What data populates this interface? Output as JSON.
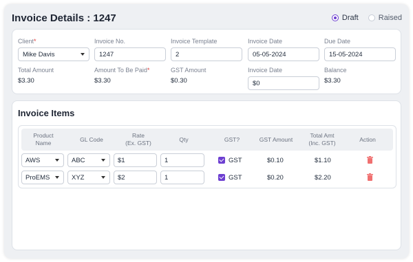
{
  "header": {
    "title": "Invoice Details : 1247",
    "status_options": [
      {
        "label": "Draft",
        "selected": true
      },
      {
        "label": "Raised",
        "selected": false
      }
    ]
  },
  "details": {
    "client_label": "Client",
    "client_value": "Mike Davis",
    "invoice_no_label": "Invoice No.",
    "invoice_no_value": "1247",
    "template_label": "Invoice Template",
    "template_value": "2",
    "invoice_date_label": "Invoice Date",
    "invoice_date_value": "05-05-2024",
    "due_date_label": "Due Date",
    "due_date_value": "15-05-2024",
    "total_label": "Total Amount",
    "total_value": "$3.30",
    "to_be_paid_label": "Amount To Be Paid",
    "to_be_paid_value": "$3.30",
    "gst_label": "GST Amount",
    "gst_value": "$0.30",
    "invoice_date2_label": "Invoice Date",
    "invoice_date2_value": "$0",
    "balance_label": "Balance",
    "balance_value": "$3.30",
    "required_mark": "*"
  },
  "items": {
    "title": "Invoice Items",
    "columns": {
      "product_1": "Product",
      "product_2": "Name",
      "gl_code": "GL Code",
      "rate_1": "Rate",
      "rate_2": "(Ex. GST)",
      "qty": "Qty",
      "gst": "GST?",
      "gst_amount": "GST Amount",
      "total_1": "Total Amt",
      "total_2": "(Inc. GST)",
      "action": "Action"
    },
    "rows": [
      {
        "product": "AWS",
        "gl_code": "ABC",
        "rate": "$1",
        "qty": "1",
        "gst_checked": true,
        "gst_label": "GST",
        "gst_amount": "$0.10",
        "total": "$1.10"
      },
      {
        "product": "ProEMS",
        "gl_code": "XYZ",
        "rate": "$2",
        "qty": "1",
        "gst_checked": true,
        "gst_label": "GST",
        "gst_amount": "$0.20",
        "total": "$2.20"
      }
    ]
  },
  "colors": {
    "accent": "#6d3fd1",
    "danger": "#f07070"
  },
  "icons": {
    "delete": "trash-icon",
    "dropdown": "chevron-down-icon"
  }
}
